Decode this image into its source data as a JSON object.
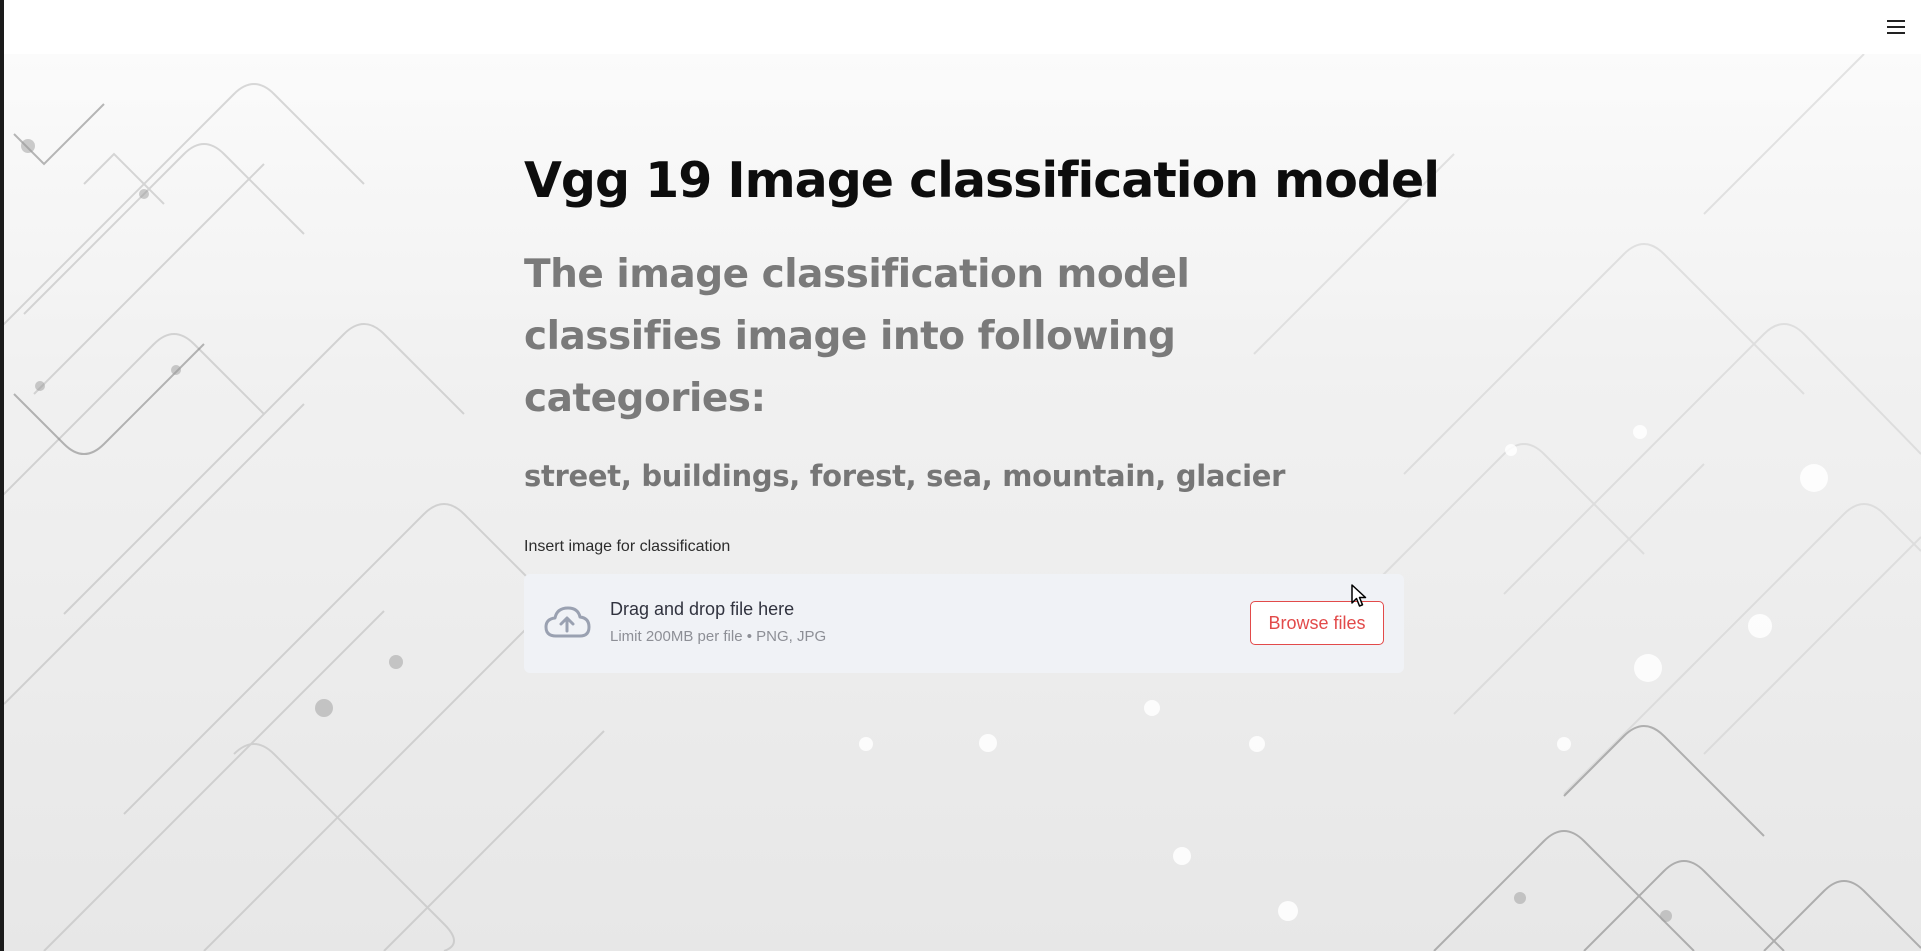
{
  "header": {
    "menu_icon": "hamburger-menu-icon"
  },
  "main": {
    "title": "Vgg 19 Image classification model",
    "subtitle": "The image classification model classifies image into following categories:",
    "categories": "street, buildings, forest, sea, mountain, glacier"
  },
  "uploader": {
    "label": "Insert image for classification",
    "icon": "cloud-upload-icon",
    "drop_text": "Drag and drop file here",
    "limit_text": "Limit 200MB per file • PNG, JPG",
    "browse_label": "Browse files"
  },
  "colors": {
    "accent": "#e24a4a",
    "dropzone_bg": "#f0f2f6",
    "title": "#0d0d0d",
    "subtitle": "#7a7a7a"
  }
}
